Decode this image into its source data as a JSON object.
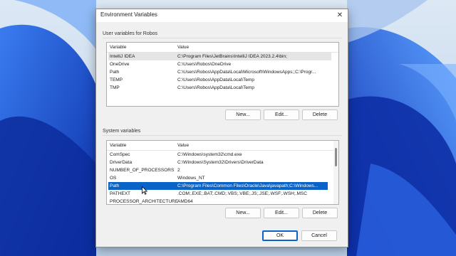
{
  "window": {
    "title": "Environment Variables",
    "close_glyph": "✕"
  },
  "user_vars": {
    "group_label": "User variables for Robos",
    "columns": [
      "Variable",
      "Value"
    ],
    "rows": [
      {
        "name": "IntelliJ IDEA",
        "value": "C:\\Program Files\\JetBrains\\IntelliJ IDEA 2023.2.4\\bin;"
      },
      {
        "name": "OneDrive",
        "value": "C:\\Users\\Robos\\OneDrive"
      },
      {
        "name": "Path",
        "value": "C:\\Users\\Robos\\AppData\\Local\\Microsoft\\WindowsApps;;C:\\Progr..."
      },
      {
        "name": "TEMP",
        "value": "C:\\Users\\Robos\\AppData\\Local\\Temp"
      },
      {
        "name": "TMP",
        "value": "C:\\Users\\Robos\\AppData\\Local\\Temp"
      }
    ],
    "buttons": {
      "new": "New...",
      "edit": "Edit...",
      "delete": "Delete"
    }
  },
  "system_vars": {
    "group_label": "System variables",
    "columns": [
      "Variable",
      "Value"
    ],
    "rows": [
      {
        "name": "ComSpec",
        "value": "C:\\Windows\\system32\\cmd.exe"
      },
      {
        "name": "DriverData",
        "value": "C:\\Windows\\System32\\Drivers\\DriverData"
      },
      {
        "name": "NUMBER_OF_PROCESSORS",
        "value": "2"
      },
      {
        "name": "OS",
        "value": "Windows_NT"
      },
      {
        "name": "Path",
        "value": "C:\\Program Files\\Common Files\\Oracle\\Java\\javapath;C:\\Windows..."
      },
      {
        "name": "PATHEXT",
        "value": ".COM;.EXE;.BAT;.CMD;.VBS;.VBE;.JS;.JSE;.WSF;.WSH;.MSC"
      },
      {
        "name": "PROCESSOR_ARCHITECTURE",
        "value": "AMD64"
      }
    ],
    "buttons": {
      "new": "New...",
      "edit": "Edit...",
      "delete": "Delete"
    }
  },
  "footer": {
    "ok": "OK",
    "cancel": "Cancel"
  },
  "colors": {
    "selection": "#0a64c8",
    "wallpaper_blue": "#1e5bd8"
  }
}
